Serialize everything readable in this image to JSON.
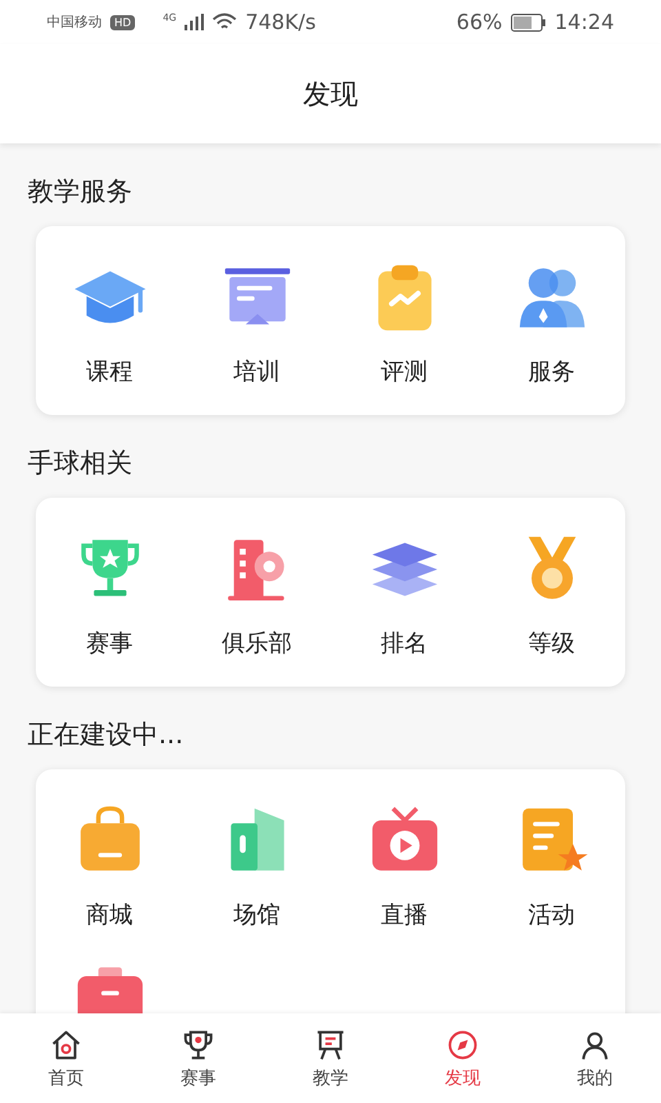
{
  "status_bar": {
    "carrier": "中国移动",
    "hd_badge": "HD",
    "network": "4G",
    "speed": "748K/s",
    "battery": "66%",
    "time": "14:24"
  },
  "header": {
    "title": "发现"
  },
  "sections": [
    {
      "title": "教学服务",
      "items": [
        {
          "label": "课程"
        },
        {
          "label": "培训"
        },
        {
          "label": "评测"
        },
        {
          "label": "服务"
        }
      ]
    },
    {
      "title": "手球相关",
      "items": [
        {
          "label": "赛事"
        },
        {
          "label": "俱乐部"
        },
        {
          "label": "排名"
        },
        {
          "label": "等级"
        }
      ]
    },
    {
      "title": "正在建设中...",
      "items": [
        {
          "label": "商城"
        },
        {
          "label": "场馆"
        },
        {
          "label": "直播"
        },
        {
          "label": "活动"
        },
        {
          "kind": "icon_only"
        }
      ]
    }
  ],
  "tab_bar": [
    {
      "label": "首页",
      "selected": false
    },
    {
      "label": "赛事",
      "selected": false
    },
    {
      "label": "教学",
      "selected": false
    },
    {
      "label": "发现",
      "selected": true
    },
    {
      "label": "我的",
      "selected": false
    }
  ]
}
